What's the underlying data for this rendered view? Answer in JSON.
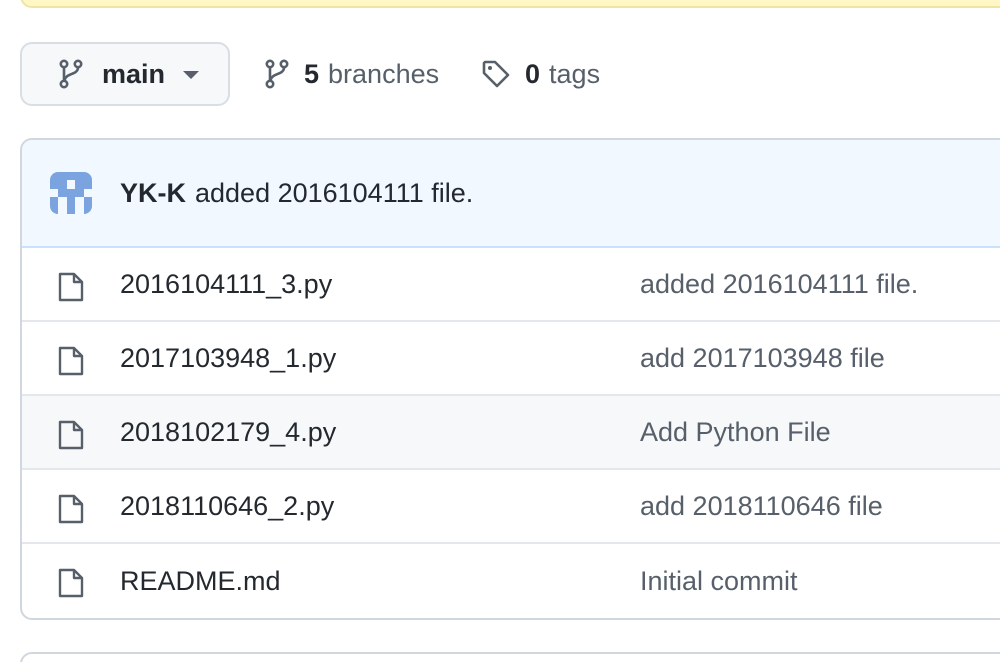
{
  "branch": {
    "current": "main",
    "branches_count": "5",
    "branches_label": "branches",
    "tags_count": "0",
    "tags_label": "tags"
  },
  "latest_commit": {
    "author": "YK-K",
    "message": "added 2016104111 file."
  },
  "files": [
    {
      "name": "2016104111_3.py",
      "commit": "added 2016104111 file."
    },
    {
      "name": "2017103948_1.py",
      "commit": "add 2017103948 file"
    },
    {
      "name": "2018102179_4.py",
      "commit": "Add Python File"
    },
    {
      "name": "2018110646_2.py",
      "commit": "add 2018110646 file"
    },
    {
      "name": "README.md",
      "commit": "Initial commit"
    }
  ],
  "colors": {
    "avatar": "#7ba3e0",
    "header_bg": "#f1f8ff",
    "banner_bg": "#fff8c5"
  }
}
